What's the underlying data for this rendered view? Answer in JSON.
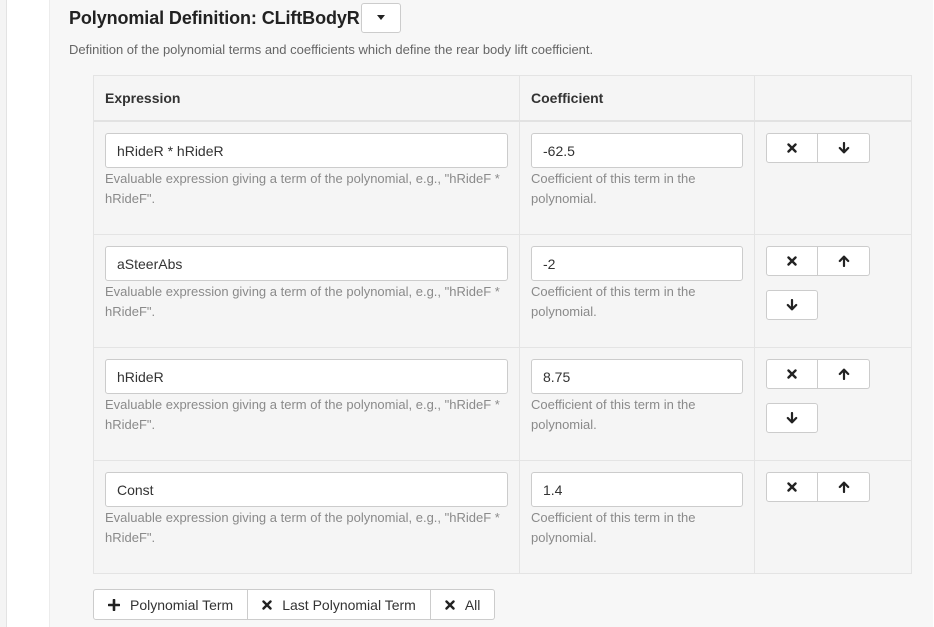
{
  "header": {
    "title": "Polynomial Definition: CLiftBodyR",
    "description": "Definition of the polynomial terms and coefficients which define the rear body lift coefficient."
  },
  "table": {
    "columns": [
      "Expression",
      "Coefficient",
      ""
    ],
    "rows": [
      {
        "expression": "hRideR * hRideR",
        "expression_help": "Evaluable expression giving a term of the polynomial, e.g., \"hRideF * hRideF\".",
        "coefficient": "-62.5",
        "coefficient_help": "Coefficient of this term in the polynomial."
      },
      {
        "expression": "aSteerAbs",
        "expression_help": "Evaluable expression giving a term of the polynomial, e.g., \"hRideF * hRideF\".",
        "coefficient": "-2",
        "coefficient_help": "Coefficient of this term in the polynomial."
      },
      {
        "expression": "hRideR",
        "expression_help": "Evaluable expression giving a term of the polynomial, e.g., \"hRideF * hRideF\".",
        "coefficient": "8.75",
        "coefficient_help": "Coefficient of this term in the polynomial."
      },
      {
        "expression": "Const",
        "expression_help": "Evaluable expression giving a term of the polynomial, e.g., \"hRideF * hRideF\".",
        "coefficient": "1.4",
        "coefficient_help": "Coefficient of this term in the polynomial."
      }
    ]
  },
  "footer": {
    "add_label": "Polynomial Term",
    "remove_last_label": "Last Polynomial Term",
    "remove_all_label": "All"
  },
  "icons": {
    "add": "plus-icon",
    "remove": "times-icon",
    "up": "arrow-up-icon",
    "down": "arrow-down-icon",
    "dropdown": "caret-down-icon"
  }
}
